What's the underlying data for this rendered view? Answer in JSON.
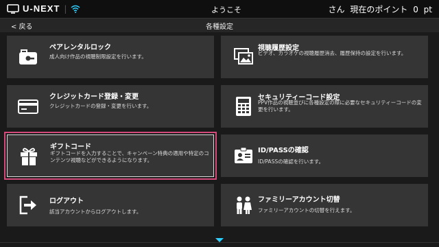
{
  "header": {
    "brand": "U-NEXT",
    "welcome": "ようこそ",
    "user_suffix": "さん",
    "points_label": "現在のポイント",
    "points_value": "0",
    "points_unit": "pt"
  },
  "nav": {
    "back_label": "< 戻る",
    "title": "各種設定"
  },
  "cards": [
    {
      "title": "ペアレンタルロック",
      "desc": "成人向け作品の視聴制限設定を行います。",
      "icon": "briefcase-lock-icon"
    },
    {
      "title": "視聴履歴設定",
      "desc": "ビデオ、カラオケの視聴履歴消去、履歴保持の設定を行います。",
      "icon": "image-history-icon"
    },
    {
      "title": "クレジットカード登録・変更",
      "desc": "クレジットカードの登録・変更を行います。",
      "icon": "credit-card-icon"
    },
    {
      "title": "セキュリティーコード設定",
      "desc": "PPV作品の視聴並びに各種設定の際に必要なセキュリティーコードの変更を行います。",
      "icon": "calculator-icon"
    },
    {
      "title": "ギフトコード",
      "desc": "ギフトコードを入力することで、キャンペーン特典の適用や特定のコンテンツ視聴などができるようになります。",
      "icon": "gift-icon"
    },
    {
      "title": "ID/PASSの確認",
      "desc": "ID/PASSの確認を行います。",
      "icon": "id-badge-icon"
    },
    {
      "title": "ログアウト",
      "desc": "該当アカウントからログアウトします。",
      "icon": "logout-icon"
    },
    {
      "title": "ファミリーアカウント切替",
      "desc": "ファミリーアカウントの切替を行えます。",
      "icon": "family-icon"
    }
  ],
  "selected_card": "ギフトコード",
  "colors": {
    "background": "#1a1a1a",
    "card": "#353535",
    "focus_outline": "#d44a7a",
    "accent": "#2fd0ff"
  }
}
